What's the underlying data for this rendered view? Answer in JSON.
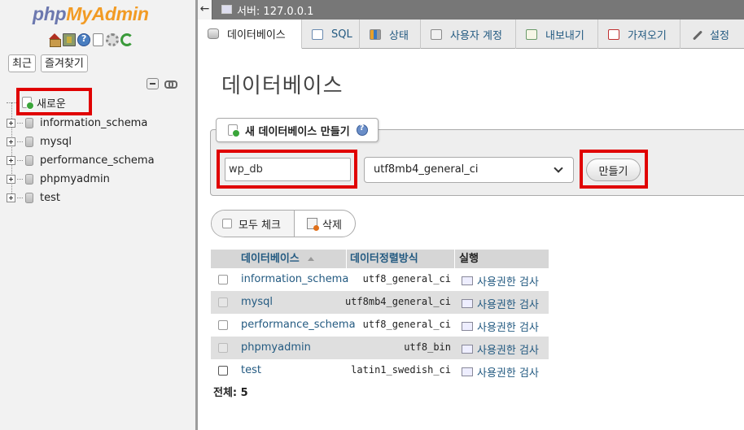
{
  "sidebar": {
    "logo_php": "php",
    "logo_myadmin": "MyAdmin",
    "icons": [
      "home-icon",
      "logout-icon",
      "help-icon",
      "documentation-icon",
      "settings-icon",
      "reload-icon"
    ],
    "recent_label": "최근",
    "favorites_label": "즐겨찾기",
    "new_label": "새로운",
    "databases": [
      "information_schema",
      "mysql",
      "performance_schema",
      "phpmyadmin",
      "test"
    ]
  },
  "topbar": {
    "back_arrow": "←",
    "server_label": "서버: 127.0.0.1"
  },
  "tabs": [
    {
      "label": "데이터베이스",
      "icon": "database-icon",
      "active": true
    },
    {
      "label": "SQL",
      "icon": "sql-icon",
      "active": false
    },
    {
      "label": "상태",
      "icon": "status-icon",
      "active": false
    },
    {
      "label": "사용자 계정",
      "icon": "users-icon",
      "active": false
    },
    {
      "label": "내보내기",
      "icon": "export-icon",
      "active": false
    },
    {
      "label": "가져오기",
      "icon": "import-icon",
      "active": false
    },
    {
      "label": "설정",
      "icon": "settings-icon",
      "active": false
    }
  ],
  "main": {
    "page_title": "데이터베이스",
    "create": {
      "legend": "새 데이터베이스 만들기",
      "name_value": "wp_db",
      "collation_value": "utf8mb4_general_ci",
      "create_button": "만들기"
    },
    "actions": {
      "check_all": "모두 체크",
      "delete": "삭제"
    },
    "table": {
      "headers": {
        "database": "데이터베이스",
        "collation": "데이터정렬방식",
        "action": "실행"
      },
      "rows": [
        {
          "name": "information_schema",
          "collation": "utf8_general_ci",
          "action": "사용권한 검사"
        },
        {
          "name": "mysql",
          "collation": "utf8mb4_general_ci",
          "action": "사용권한 검사"
        },
        {
          "name": "performance_schema",
          "collation": "utf8_general_ci",
          "action": "사용권한 검사"
        },
        {
          "name": "phpmyadmin",
          "collation": "utf8_bin",
          "action": "사용권한 검사"
        },
        {
          "name": "test",
          "collation": "latin1_swedish_ci",
          "action": "사용권한 검사"
        }
      ],
      "total": "전체: 5"
    }
  },
  "colors": {
    "link": "#235a81",
    "highlight": "#e00000",
    "logo_php": "#6c78af",
    "logo_myadmin": "#f29b24"
  }
}
